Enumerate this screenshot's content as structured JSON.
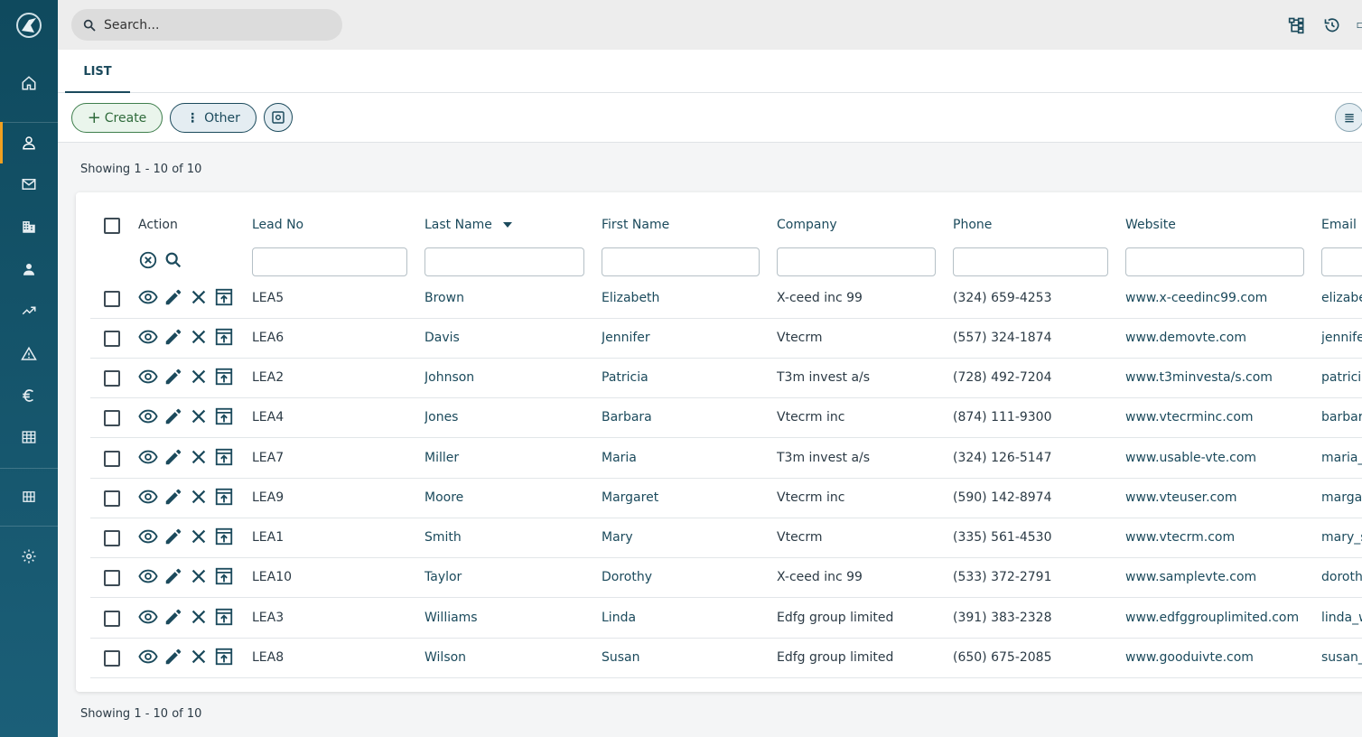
{
  "search": {
    "placeholder": "Search..."
  },
  "tabs": [
    {
      "label": "LIST"
    }
  ],
  "toolbar": {
    "create_label": "Create",
    "other_label": "Other"
  },
  "pagination": {
    "top_text": "Showing 1 - 10 of 10",
    "bottom_text": "Showing 1 - 10 of 10"
  },
  "table": {
    "headers": {
      "action": "Action",
      "lead_no": "Lead No",
      "last_name": "Last Name",
      "first_name": "First Name",
      "company": "Company",
      "phone": "Phone",
      "website": "Website",
      "email": "Email"
    },
    "sorted_column": "last_name",
    "rows": [
      {
        "lead_no": "LEA5",
        "last_name": "Brown",
        "first_name": "Elizabeth",
        "company": "X-ceed inc 99",
        "phone": "(324) 659-4253",
        "website": "www.x-ceedinc99.com",
        "email": "elizabe"
      },
      {
        "lead_no": "LEA6",
        "last_name": "Davis",
        "first_name": "Jennifer",
        "company": "Vtecrm",
        "phone": "(557) 324-1874",
        "website": "www.demovte.com",
        "email": "jennife"
      },
      {
        "lead_no": "LEA2",
        "last_name": "Johnson",
        "first_name": "Patricia",
        "company": "T3m invest a/s",
        "phone": "(728) 492-7204",
        "website": "www.t3minvesta/s.com",
        "email": "patricia"
      },
      {
        "lead_no": "LEA4",
        "last_name": "Jones",
        "first_name": "Barbara",
        "company": "Vtecrm inc",
        "phone": "(874) 111-9300",
        "website": "www.vtecrminc.com",
        "email": "barbar"
      },
      {
        "lead_no": "LEA7",
        "last_name": "Miller",
        "first_name": "Maria",
        "company": "T3m invest a/s",
        "phone": "(324) 126-5147",
        "website": "www.usable-vte.com",
        "email": "maria_"
      },
      {
        "lead_no": "LEA9",
        "last_name": "Moore",
        "first_name": "Margaret",
        "company": "Vtecrm inc",
        "phone": "(590) 142-8974",
        "website": "www.vteuser.com",
        "email": "margar"
      },
      {
        "lead_no": "LEA1",
        "last_name": "Smith",
        "first_name": "Mary",
        "company": "Vtecrm",
        "phone": "(335) 561-4530",
        "website": "www.vtecrm.com",
        "email": "mary_s"
      },
      {
        "lead_no": "LEA10",
        "last_name": "Taylor",
        "first_name": "Dorothy",
        "company": "X-ceed inc 99",
        "phone": "(533) 372-2791",
        "website": "www.samplevte.com",
        "email": "doroth"
      },
      {
        "lead_no": "LEA3",
        "last_name": "Williams",
        "first_name": "Linda",
        "company": "Edfg group limited",
        "phone": "(391) 383-2328",
        "website": "www.edfggrouplimited.com",
        "email": "linda_w"
      },
      {
        "lead_no": "LEA8",
        "last_name": "Wilson",
        "first_name": "Susan",
        "company": "Edfg group limited",
        "phone": "(650) 675-2085",
        "website": "www.gooduivte.com",
        "email": "susan_"
      }
    ]
  },
  "sidebar": {
    "items": [
      {
        "icon": "home-icon"
      },
      {
        "icon": "user-icon",
        "active": true
      },
      {
        "icon": "mail-icon"
      },
      {
        "icon": "building-icon"
      },
      {
        "icon": "person-icon"
      },
      {
        "icon": "trending-up-icon"
      },
      {
        "icon": "warning-icon"
      },
      {
        "icon": "euro-icon"
      },
      {
        "icon": "table-icon"
      },
      {
        "icon": "grid-icon"
      },
      {
        "icon": "gear-icon"
      }
    ]
  },
  "colors": {
    "sidebar": "#0f4a5e",
    "accent": "#f0a020",
    "primary": "#1b4a5c",
    "create": "#3e7e4c"
  }
}
